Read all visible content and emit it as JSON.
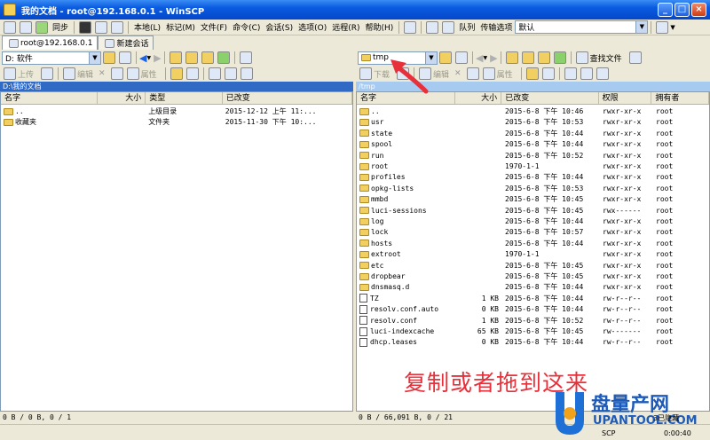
{
  "window": {
    "title": "我的文档 - root@192.168.0.1 - WinSCP",
    "minimize": "_",
    "maximize": "□",
    "close": "×"
  },
  "toolbar": {
    "sync_label": "同步",
    "menus": [
      "本地(L)",
      "标记(M)",
      "文件(F)",
      "命令(C)",
      "会话(S)",
      "选项(O)",
      "远程(R)",
      "帮助(H)"
    ],
    "queue_label": "队列",
    "transfer_options_label": "传输选项",
    "transfer_mode": "默认"
  },
  "tabs": [
    {
      "label": "root@192.168.0.1"
    },
    {
      "label": "新建会话"
    }
  ],
  "left": {
    "drive": "D: 软件",
    "toolbar": {
      "upload": "上传",
      "edit": "编辑",
      "props": "属性"
    },
    "path": "D:\\我的文档",
    "columns": [
      "名字",
      "大小",
      "类型",
      "已改变"
    ],
    "files": [
      {
        "name": "..",
        "size": "",
        "type": "上级目录",
        "date": "2015-12-12",
        "time": "上午 11:..."
      },
      {
        "name": "收藏夹",
        "size": "",
        "type": "文件夹",
        "date": "2015-11-30",
        "time": "下午 10:..."
      }
    ],
    "status": "0 B / 0 B, 0 / 1"
  },
  "right": {
    "dir": "tmp",
    "toolbar": {
      "download": "下载",
      "edit": "编辑",
      "props": "属性",
      "find": "查找文件"
    },
    "path": "/tmp",
    "columns": [
      "名字",
      "大小",
      "已改变",
      "权限",
      "拥有者"
    ],
    "files": [
      {
        "name": "..",
        "size": "",
        "date": "2015-6-8",
        "time": "下午 10:46",
        "perm": "rwxr-xr-x",
        "owner": "root",
        "kind": "up"
      },
      {
        "name": "usr",
        "size": "",
        "date": "2015-6-8",
        "time": "下午 10:53",
        "perm": "rwxr-xr-x",
        "owner": "root",
        "kind": "folder"
      },
      {
        "name": "state",
        "size": "",
        "date": "2015-6-8",
        "time": "下午 10:44",
        "perm": "rwxr-xr-x",
        "owner": "root",
        "kind": "folder"
      },
      {
        "name": "spool",
        "size": "",
        "date": "2015-6-8",
        "time": "下午 10:44",
        "perm": "rwxr-xr-x",
        "owner": "root",
        "kind": "folder"
      },
      {
        "name": "run",
        "size": "",
        "date": "2015-6-8",
        "time": "下午 10:52",
        "perm": "rwxr-xr-x",
        "owner": "root",
        "kind": "folder"
      },
      {
        "name": "root",
        "size": "",
        "date": "1970-1-1",
        "time": "",
        "perm": "rwxr-xr-x",
        "owner": "root",
        "kind": "folder"
      },
      {
        "name": "profiles",
        "size": "",
        "date": "2015-6-8",
        "time": "下午 10:44",
        "perm": "rwxr-xr-x",
        "owner": "root",
        "kind": "folder"
      },
      {
        "name": "opkg-lists",
        "size": "",
        "date": "2015-6-8",
        "time": "下午 10:53",
        "perm": "rwxr-xr-x",
        "owner": "root",
        "kind": "folder"
      },
      {
        "name": "mmbd",
        "size": "",
        "date": "2015-6-8",
        "time": "下午 10:45",
        "perm": "rwxr-xr-x",
        "owner": "root",
        "kind": "folder"
      },
      {
        "name": "luci-sessions",
        "size": "",
        "date": "2015-6-8",
        "time": "下午 10:45",
        "perm": "rwx------",
        "owner": "root",
        "kind": "folder"
      },
      {
        "name": "log",
        "size": "",
        "date": "2015-6-8",
        "time": "下午 10:44",
        "perm": "rwxr-xr-x",
        "owner": "root",
        "kind": "folder"
      },
      {
        "name": "lock",
        "size": "",
        "date": "2015-6-8",
        "time": "下午 10:57",
        "perm": "rwxr-xr-x",
        "owner": "root",
        "kind": "folder"
      },
      {
        "name": "hosts",
        "size": "",
        "date": "2015-6-8",
        "time": "下午 10:44",
        "perm": "rwxr-xr-x",
        "owner": "root",
        "kind": "folder"
      },
      {
        "name": "extroot",
        "size": "",
        "date": "1970-1-1",
        "time": "",
        "perm": "rwxr-xr-x",
        "owner": "root",
        "kind": "folder"
      },
      {
        "name": "etc",
        "size": "",
        "date": "2015-6-8",
        "time": "下午 10:45",
        "perm": "rwxr-xr-x",
        "owner": "root",
        "kind": "folder"
      },
      {
        "name": "dropbear",
        "size": "",
        "date": "2015-6-8",
        "time": "下午 10:45",
        "perm": "rwxr-xr-x",
        "owner": "root",
        "kind": "folder"
      },
      {
        "name": "dnsmasq.d",
        "size": "",
        "date": "2015-6-8",
        "time": "下午 10:44",
        "perm": "rwxr-xr-x",
        "owner": "root",
        "kind": "folder"
      },
      {
        "name": "TZ",
        "size": "1 KB",
        "date": "2015-6-8",
        "time": "下午 10:44",
        "perm": "rw-r--r--",
        "owner": "root",
        "kind": "file"
      },
      {
        "name": "resolv.conf.auto",
        "size": "0 KB",
        "date": "2015-6-8",
        "time": "下午 10:44",
        "perm": "rw-r--r--",
        "owner": "root",
        "kind": "file"
      },
      {
        "name": "resolv.conf",
        "size": "1 KB",
        "date": "2015-6-8",
        "time": "下午 10:52",
        "perm": "rw-r--r--",
        "owner": "root",
        "kind": "file"
      },
      {
        "name": "luci-indexcache",
        "size": "65 KB",
        "date": "2015-6-8",
        "time": "下午 10:45",
        "perm": "rw-------",
        "owner": "root",
        "kind": "file"
      },
      {
        "name": "dhcp.leases",
        "size": "0 KB",
        "date": "2015-6-8",
        "time": "下午 10:44",
        "perm": "rw-r--r--",
        "owner": "root",
        "kind": "file"
      }
    ],
    "status": "0 B / 66,091 B, 0 / 21"
  },
  "annotation": "复制或者拖到这来",
  "watermark": {
    "brand": "盘量产网",
    "url": "UPANTOOL.COM",
    "hidden": "3已隐藏",
    "protocol": "SCP",
    "time": "0:00:40"
  },
  "colors": {
    "title": "#0a5be0",
    "annotation": "#e8303a",
    "path_active": "#316ac5"
  }
}
